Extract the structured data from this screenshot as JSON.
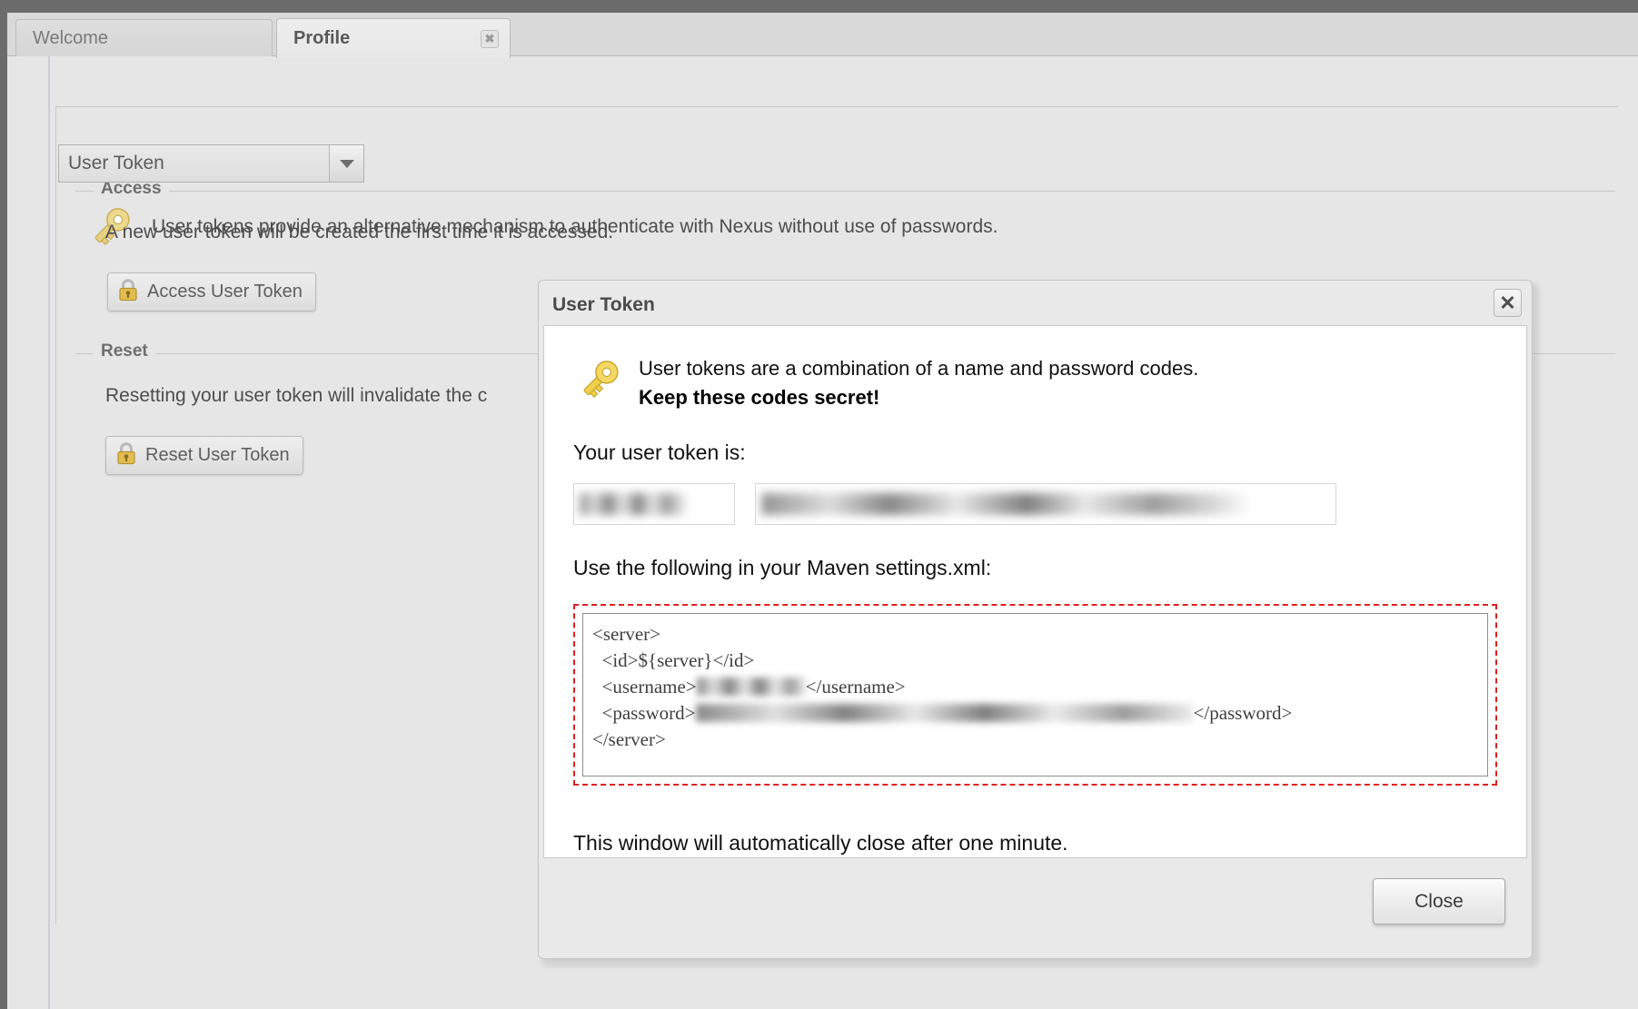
{
  "tabs": [
    {
      "label": "Welcome",
      "active": false,
      "closable": false
    },
    {
      "label": "Profile",
      "active": true,
      "closable": true,
      "close_icon": "close-icon"
    }
  ],
  "panel": {
    "selector": {
      "value": "User Token",
      "caret_icon": "chevron-down-icon"
    },
    "key_icon": "key-icon",
    "intro_text": "User tokens provide an alternative mechanism to authenticate with Nexus without use of passwords.",
    "access_group": {
      "legend": "Access",
      "description": "A new user token will be created the first time it is accessed.",
      "button": {
        "label": "Access User Token",
        "icon": "lock-icon"
      }
    },
    "reset_group": {
      "legend": "Reset",
      "description": "Resetting your user token will invalidate the c",
      "button": {
        "label": "Reset User Token",
        "icon": "lock-icon"
      }
    }
  },
  "dialog": {
    "title": "User Token",
    "close_icon": "close-icon",
    "key_icon": "key-icon",
    "intro_line1": "User tokens are a combination of a name and password codes.",
    "intro_line2": "Keep these codes secret!",
    "token_label": "Your user token is:",
    "token_name_code": "",
    "token_pass_code": "",
    "settings_label": "Use the following in your Maven settings.xml:",
    "code": {
      "line1": "<server>",
      "line2_pre": "  <id>${server}</id>",
      "line3_pre": "  <username>",
      "line3_post": "</username>",
      "line4_pre": "  <password>",
      "line4_post": "</password>",
      "line5": "</server>",
      "username_value": "",
      "password_value": ""
    },
    "note": "This window will automatically close after one minute.",
    "footer_button": "Close"
  },
  "colors": {
    "accent_red": "#e02020",
    "chrome_dark": "#6b6b6b",
    "panel_bg": "#e6e6e6",
    "key_gold": "#e9d27a"
  }
}
